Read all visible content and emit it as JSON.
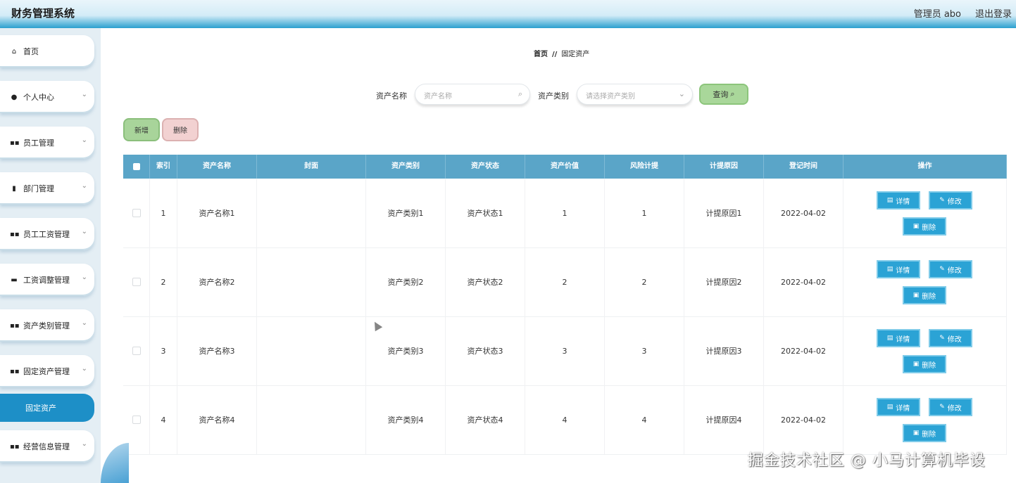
{
  "header": {
    "app_title": "财务管理系统",
    "user_info": "管理员 abo",
    "logout": "退出登录"
  },
  "sidebar": {
    "items": [
      {
        "label": "首页",
        "icon": "home-icon",
        "glyph": "⌂",
        "chevron": false
      },
      {
        "label": "个人中心",
        "icon": "user-icon",
        "glyph": "●",
        "chevron": true
      },
      {
        "label": "员工管理",
        "icon": "grid-icon",
        "glyph": "▪▪",
        "chevron": true
      },
      {
        "label": "部门管理",
        "icon": "bar-chart-icon",
        "glyph": "▮",
        "chevron": true
      },
      {
        "label": "员工工资管理",
        "icon": "grid-icon",
        "glyph": "▪▪",
        "chevron": true
      },
      {
        "label": "工资调整管理",
        "icon": "clipboard-icon",
        "glyph": "▬",
        "chevron": true
      },
      {
        "label": "资产类别管理",
        "icon": "grid-icon",
        "glyph": "▪▪",
        "chevron": true
      },
      {
        "label": "固定资产管理",
        "icon": "grid-icon",
        "glyph": "▪▪",
        "chevron": true
      },
      {
        "label": "经营信息管理",
        "icon": "grid-icon",
        "glyph": "▪▪",
        "chevron": true
      }
    ],
    "active_sub": "固定资产"
  },
  "breadcrumb": {
    "home": "首页",
    "separator": "//",
    "current": "固定资产"
  },
  "search": {
    "name_label": "资产名称",
    "name_placeholder": "资产名称",
    "category_label": "资产类别",
    "category_placeholder": "请选择资产类别",
    "query_button": "查询"
  },
  "actions": {
    "add": "新增",
    "delete": "删除"
  },
  "table": {
    "headers": [
      "索引",
      "资产名称",
      "封面",
      "资产类别",
      "资产状态",
      "资产价值",
      "风险计提",
      "计提原因",
      "登记时间",
      "操作"
    ],
    "rows": [
      {
        "index": "1",
        "name": "资产名称1",
        "cover": "",
        "category": "资产类别1",
        "status": "资产状态1",
        "value": "1",
        "risk": "1",
        "reason": "计提原因1",
        "time": "2022-04-02"
      },
      {
        "index": "2",
        "name": "资产名称2",
        "cover": "",
        "category": "资产类别2",
        "status": "资产状态2",
        "value": "2",
        "risk": "2",
        "reason": "计提原因2",
        "time": "2022-04-02"
      },
      {
        "index": "3",
        "name": "资产名称3",
        "cover": "",
        "category": "资产类别3",
        "status": "资产状态3",
        "value": "3",
        "risk": "3",
        "reason": "计提原因3",
        "time": "2022-04-02"
      },
      {
        "index": "4",
        "name": "资产名称4",
        "cover": "",
        "category": "资产类别4",
        "status": "资产状态4",
        "value": "4",
        "risk": "4",
        "reason": "计提原因4",
        "time": "2022-04-02"
      }
    ],
    "row_actions": {
      "detail": "详情",
      "edit": "修改",
      "delete": "删除"
    }
  },
  "watermark": "掘金技术社区 @ 小马计算机毕设",
  "colors": {
    "header_gradient_end": "#2aa0cf",
    "active_menu": "#1d8fc7",
    "table_head": "#5aa5c8",
    "op_button": "#2ba3d5"
  }
}
